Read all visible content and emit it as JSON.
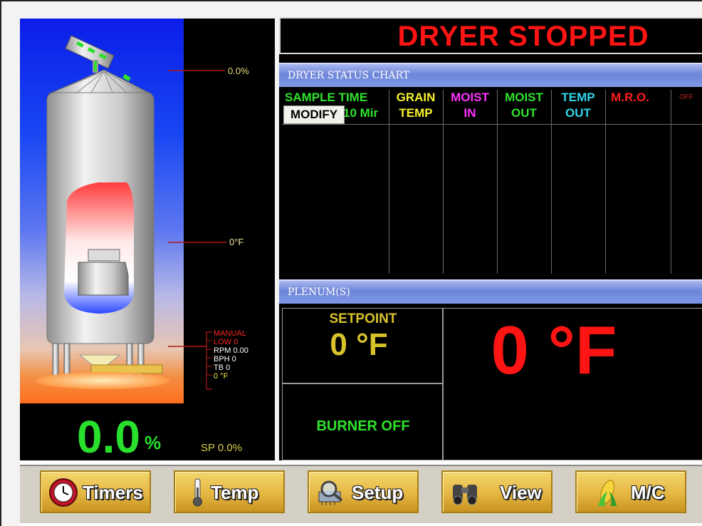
{
  "status": {
    "title": "DRYER STOPPED"
  },
  "silo": {
    "level_label": "0.0%",
    "temp_label": "0°F",
    "big_percent": "0.0",
    "big_percent_unit": "%",
    "setpoint_label": "SP 0.0%",
    "mode": "MANUAL",
    "low": "LOW 0",
    "rpm": "RPM 0.00",
    "bph": "BPH 0",
    "tb": "TB 0",
    "temp": "0 °F"
  },
  "dryer_status_chart": {
    "title": "DRYER STATUS CHART",
    "columns": [
      {
        "line1": "SAMPLE TIME",
        "line2": "10 Mir",
        "color": "#2fe32b"
      },
      {
        "line1": "GRAIN",
        "line2": "TEMP",
        "color": "#f6f22c"
      },
      {
        "line1": "MOIST",
        "line2": "IN",
        "color": "#ff33ff"
      },
      {
        "line1": "MOIST",
        "line2": "OUT",
        "color": "#2fe32b"
      },
      {
        "line1": "TEMP",
        "line2": "OUT",
        "color": "#2fd6e8"
      },
      {
        "line1": "M.R.O.",
        "line2": "",
        "color": "#ff1e1e"
      },
      {
        "line1": "OFF",
        "line2": "",
        "color": "#8a1a1a"
      }
    ],
    "modify_label": "MODIFY"
  },
  "plenum": {
    "title": "PLENUM(S)",
    "setpoint_label": "SETPOINT",
    "setpoint_value": "0 °F",
    "current_value": "0 °F",
    "burner_status": "BURNER OFF"
  },
  "buttons": [
    {
      "label": "Timers",
      "icon": "clock-icon"
    },
    {
      "label": "Temp",
      "icon": "thermometer-icon"
    },
    {
      "label": "Setup",
      "icon": "magnifier-chip-icon"
    },
    {
      "label": "View",
      "icon": "binoculars-icon"
    },
    {
      "label": "M/C",
      "icon": "corn-icon"
    }
  ],
  "colors": {
    "accent_red": "#ff1414",
    "accent_green": "#29e02d",
    "accent_yellow": "#f6f22c"
  }
}
